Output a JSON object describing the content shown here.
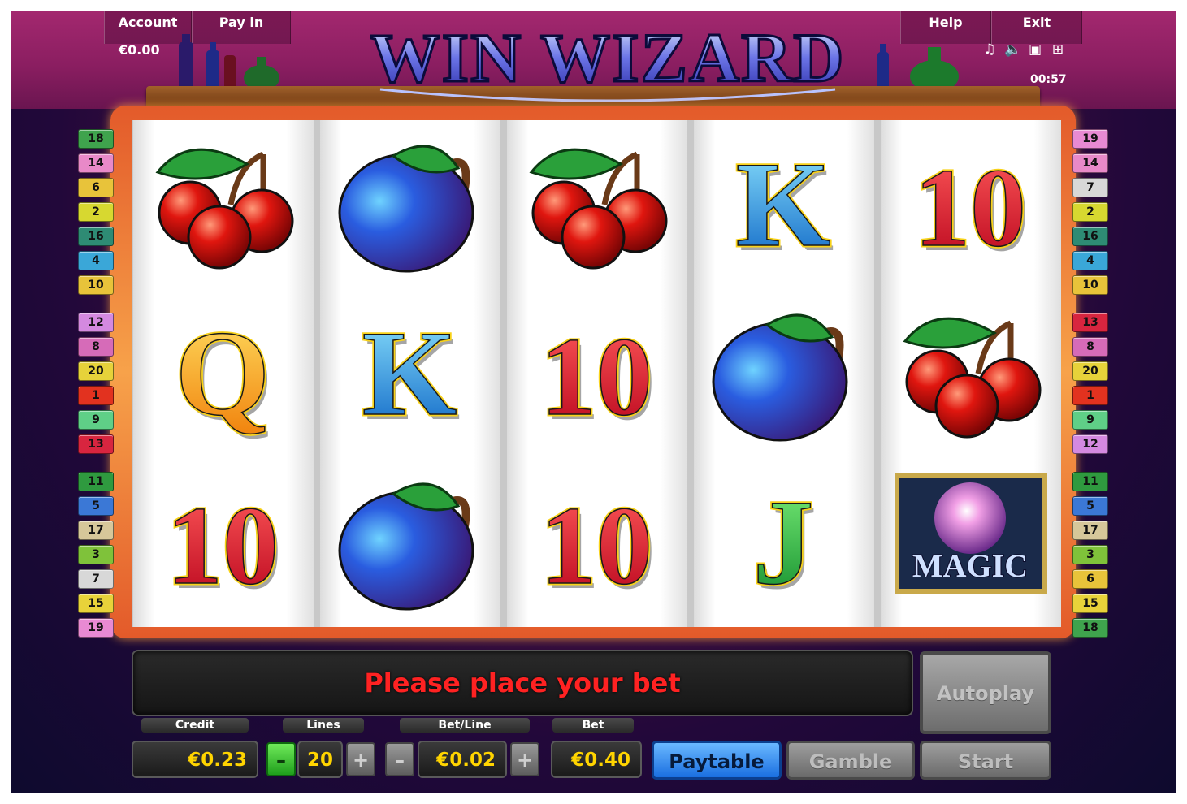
{
  "header": {
    "account_label": "Account",
    "payin_label": "Pay in",
    "help_label": "Help",
    "exit_label": "Exit",
    "balance": "€0.00",
    "clock": "00:57",
    "icons": [
      "music-icon",
      "speaker-icon",
      "fullscreen-icon",
      "settings-icon"
    ]
  },
  "game": {
    "title": "WIN WIZARD"
  },
  "reels": [
    [
      "cherry",
      "Q",
      "10"
    ],
    [
      "plum",
      "K",
      "plum"
    ],
    [
      "cherry",
      "10",
      "10"
    ],
    [
      "K",
      "plum",
      "J"
    ],
    [
      "10",
      "cherry",
      "magic"
    ]
  ],
  "magic_label": "MAGIC",
  "line_tags": {
    "left": [
      {
        "n": "18",
        "c": "#3fa34d"
      },
      {
        "n": "14",
        "c": "#e889c8"
      },
      {
        "n": "6",
        "c": "#e8c33a"
      },
      {
        "n": "2",
        "c": "#d7d830"
      },
      {
        "n": "16",
        "c": "#2e8b74"
      },
      {
        "n": "4",
        "c": "#3aa7d8"
      },
      {
        "n": "10",
        "c": "#e8c33a"
      },
      {
        "n": "12",
        "c": "#d489e0"
      },
      {
        "n": "8",
        "c": "#d66bb8"
      },
      {
        "n": "20",
        "c": "#e6d23a"
      },
      {
        "n": "1",
        "c": "#e2321f"
      },
      {
        "n": "9",
        "c": "#5fcf87"
      },
      {
        "n": "13",
        "c": "#d8253f"
      },
      {
        "n": "11",
        "c": "#2f9a3f"
      },
      {
        "n": "5",
        "c": "#3b78d6"
      },
      {
        "n": "17",
        "c": "#d6c79a"
      },
      {
        "n": "3",
        "c": "#7fc23a"
      },
      {
        "n": "7",
        "c": "#d8d8d8"
      },
      {
        "n": "15",
        "c": "#e8d23a"
      },
      {
        "n": "19",
        "c": "#e88ad3"
      }
    ],
    "right": [
      {
        "n": "19",
        "c": "#e88ad3"
      },
      {
        "n": "14",
        "c": "#e889c8"
      },
      {
        "n": "7",
        "c": "#d8d8d8"
      },
      {
        "n": "2",
        "c": "#d7d830"
      },
      {
        "n": "16",
        "c": "#2e8b74"
      },
      {
        "n": "4",
        "c": "#3aa7d8"
      },
      {
        "n": "10",
        "c": "#e8c33a"
      },
      {
        "n": "13",
        "c": "#d8253f"
      },
      {
        "n": "8",
        "c": "#d66bb8"
      },
      {
        "n": "20",
        "c": "#e6d23a"
      },
      {
        "n": "1",
        "c": "#e2321f"
      },
      {
        "n": "9",
        "c": "#5fcf87"
      },
      {
        "n": "12",
        "c": "#d489e0"
      },
      {
        "n": "11",
        "c": "#2f9a3f"
      },
      {
        "n": "5",
        "c": "#3b78d6"
      },
      {
        "n": "17",
        "c": "#d6c79a"
      },
      {
        "n": "3",
        "c": "#7fc23a"
      },
      {
        "n": "6",
        "c": "#e8c33a"
      },
      {
        "n": "15",
        "c": "#e8d23a"
      },
      {
        "n": "18",
        "c": "#3fa34d"
      }
    ]
  },
  "panel": {
    "message": "Please place your bet",
    "credit_label": "Credit",
    "credit_value": "€0.23",
    "lines_label": "Lines",
    "lines_value": "20",
    "betline_label": "Bet/Line",
    "betline_value": "€0.02",
    "bet_label": "Bet",
    "bet_value": "€0.40",
    "minus": "–",
    "plus": "+",
    "paytable_label": "Paytable",
    "gamble_label": "Gamble",
    "start_label": "Start",
    "autoplay_label": "Autoplay"
  }
}
